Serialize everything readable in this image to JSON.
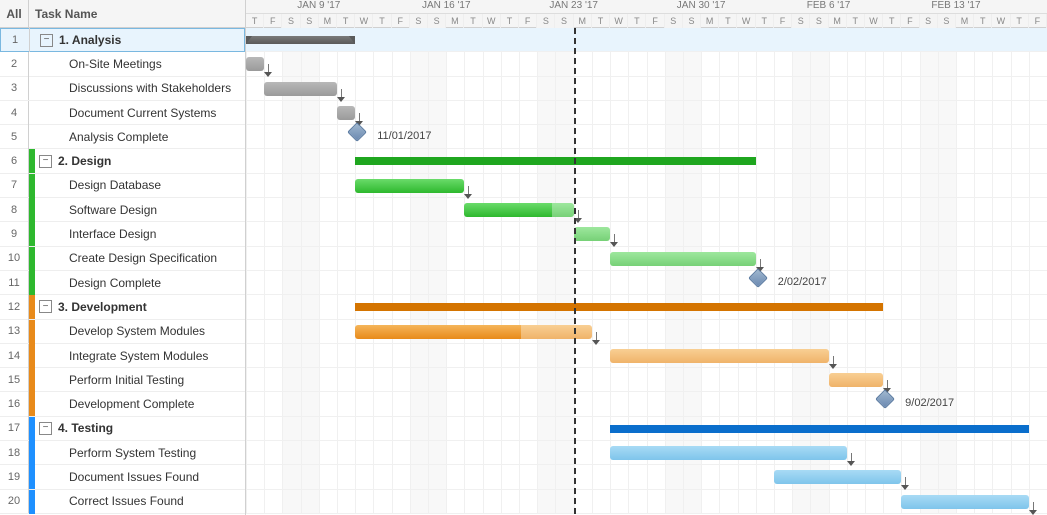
{
  "header": {
    "all": "All",
    "task_name": "Task Name"
  },
  "timeline": {
    "start": "2017-01-05",
    "days": 44,
    "today": "2017-01-23",
    "weeks": [
      {
        "label": "JAN 9 '17",
        "date": "2017-01-09"
      },
      {
        "label": "JAN 16 '17",
        "date": "2017-01-16"
      },
      {
        "label": "JAN 23 '17",
        "date": "2017-01-23"
      },
      {
        "label": "JAN 30 '17",
        "date": "2017-01-30"
      },
      {
        "label": "FEB 6 '17",
        "date": "2017-02-06"
      },
      {
        "label": "FEB 13 '17",
        "date": "2017-02-13"
      }
    ],
    "day_letters": [
      "S",
      "M",
      "T",
      "W",
      "T",
      "F",
      "S"
    ]
  },
  "tasks": [
    {
      "row": 1,
      "name": "1. Analysis",
      "phase": true,
      "color": "grey",
      "start": "2017-01-05",
      "end": "2017-01-11",
      "progress": 1,
      "selected": true
    },
    {
      "row": 2,
      "name": "On-Site Meetings",
      "parent": 1,
      "color": "grey",
      "start": "2017-01-05",
      "end": "2017-01-06",
      "progress": 1
    },
    {
      "row": 3,
      "name": "Discussions with Stakeholders",
      "parent": 1,
      "color": "grey",
      "start": "2017-01-06",
      "end": "2017-01-10",
      "progress": 1
    },
    {
      "row": 4,
      "name": "Document Current Systems",
      "parent": 1,
      "color": "grey",
      "start": "2017-01-10",
      "end": "2017-01-11",
      "progress": 1
    },
    {
      "row": 5,
      "name": "Analysis Complete",
      "parent": 1,
      "milestone": true,
      "start": "2017-01-11",
      "label": "11/01/2017"
    },
    {
      "row": 6,
      "name": "2. Design",
      "phase": true,
      "color": "green",
      "start": "2017-01-11",
      "end": "2017-02-02",
      "progress": 0.55
    },
    {
      "row": 7,
      "name": "Design Database",
      "parent": 6,
      "color": "green",
      "start": "2017-01-11",
      "end": "2017-01-17",
      "progress": 1
    },
    {
      "row": 8,
      "name": "Software Design",
      "parent": 6,
      "color": "green",
      "start": "2017-01-17",
      "end": "2017-01-23",
      "progress": 0.8
    },
    {
      "row": 9,
      "name": "Interface Design",
      "parent": 6,
      "color": "green",
      "start": "2017-01-23",
      "end": "2017-01-25",
      "progress": 0
    },
    {
      "row": 10,
      "name": "Create Design Specification",
      "parent": 6,
      "color": "green",
      "start": "2017-01-25",
      "end": "2017-02-02",
      "progress": 0
    },
    {
      "row": 11,
      "name": "Design Complete",
      "parent": 6,
      "milestone": true,
      "start": "2017-02-02",
      "label": "2/02/2017"
    },
    {
      "row": 12,
      "name": "3. Development",
      "phase": true,
      "color": "orange",
      "start": "2017-01-11",
      "end": "2017-02-09",
      "progress": 0.3
    },
    {
      "row": 13,
      "name": "Develop System Modules",
      "parent": 12,
      "color": "orange",
      "start": "2017-01-11",
      "end": "2017-01-24",
      "progress": 0.7
    },
    {
      "row": 14,
      "name": "Integrate System Modules",
      "parent": 12,
      "color": "orange",
      "start": "2017-01-25",
      "end": "2017-02-06",
      "progress": 0
    },
    {
      "row": 15,
      "name": "Perform Initial Testing",
      "parent": 12,
      "color": "orange",
      "start": "2017-02-06",
      "end": "2017-02-09",
      "progress": 0
    },
    {
      "row": 16,
      "name": "Development Complete",
      "parent": 12,
      "milestone": true,
      "start": "2017-02-09",
      "label": "9/02/2017"
    },
    {
      "row": 17,
      "name": "4. Testing",
      "phase": true,
      "color": "blue",
      "start": "2017-01-25",
      "end": "2017-02-17",
      "progress": 0
    },
    {
      "row": 18,
      "name": "Perform System Testing",
      "parent": 17,
      "color": "blue",
      "start": "2017-01-25",
      "end": "2017-02-07",
      "progress": 0
    },
    {
      "row": 19,
      "name": "Document Issues Found",
      "parent": 17,
      "color": "blue",
      "start": "2017-02-03",
      "end": "2017-02-10",
      "progress": 0
    },
    {
      "row": 20,
      "name": "Correct Issues Found",
      "parent": 17,
      "color": "blue",
      "start": "2017-02-10",
      "end": "2017-02-17",
      "progress": 0
    }
  ],
  "chart_data": {
    "type": "gantt",
    "title": "",
    "x_start": "2017-01-05",
    "x_end": "2017-02-17",
    "today_marker": "2017-01-23",
    "series": [
      {
        "id": 1,
        "name": "1. Analysis",
        "type": "summary",
        "start": "2017-01-05",
        "end": "2017-01-11",
        "progress": 1.0
      },
      {
        "id": 2,
        "name": "On-Site Meetings",
        "type": "task",
        "start": "2017-01-05",
        "end": "2017-01-06",
        "progress": 1.0,
        "parent": 1
      },
      {
        "id": 3,
        "name": "Discussions with Stakeholders",
        "type": "task",
        "start": "2017-01-06",
        "end": "2017-01-10",
        "progress": 1.0,
        "parent": 1,
        "depends": [
          2
        ]
      },
      {
        "id": 4,
        "name": "Document Current Systems",
        "type": "task",
        "start": "2017-01-10",
        "end": "2017-01-11",
        "progress": 1.0,
        "parent": 1,
        "depends": [
          3
        ]
      },
      {
        "id": 5,
        "name": "Analysis Complete",
        "type": "milestone",
        "start": "2017-01-11",
        "label": "11/01/2017",
        "parent": 1,
        "depends": [
          4
        ]
      },
      {
        "id": 6,
        "name": "2. Design",
        "type": "summary",
        "start": "2017-01-11",
        "end": "2017-02-02",
        "progress": 0.55
      },
      {
        "id": 7,
        "name": "Design Database",
        "type": "task",
        "start": "2017-01-11",
        "end": "2017-01-17",
        "progress": 1.0,
        "parent": 6,
        "depends": [
          5
        ]
      },
      {
        "id": 8,
        "name": "Software Design",
        "type": "task",
        "start": "2017-01-17",
        "end": "2017-01-23",
        "progress": 0.8,
        "parent": 6,
        "depends": [
          7
        ]
      },
      {
        "id": 9,
        "name": "Interface Design",
        "type": "task",
        "start": "2017-01-23",
        "end": "2017-01-25",
        "progress": 0.0,
        "parent": 6,
        "depends": [
          8
        ]
      },
      {
        "id": 10,
        "name": "Create Design Specification",
        "type": "task",
        "start": "2017-01-25",
        "end": "2017-02-02",
        "progress": 0.0,
        "parent": 6,
        "depends": [
          9
        ]
      },
      {
        "id": 11,
        "name": "Design Complete",
        "type": "milestone",
        "start": "2017-02-02",
        "label": "2/02/2017",
        "parent": 6,
        "depends": [
          10
        ]
      },
      {
        "id": 12,
        "name": "3. Development",
        "type": "summary",
        "start": "2017-01-11",
        "end": "2017-02-09",
        "progress": 0.3
      },
      {
        "id": 13,
        "name": "Develop System Modules",
        "type": "task",
        "start": "2017-01-11",
        "end": "2017-01-24",
        "progress": 0.7,
        "parent": 12
      },
      {
        "id": 14,
        "name": "Integrate System Modules",
        "type": "task",
        "start": "2017-01-25",
        "end": "2017-02-06",
        "progress": 0.0,
        "parent": 12,
        "depends": [
          13
        ]
      },
      {
        "id": 15,
        "name": "Perform Initial Testing",
        "type": "task",
        "start": "2017-02-06",
        "end": "2017-02-09",
        "progress": 0.0,
        "parent": 12,
        "depends": [
          14
        ]
      },
      {
        "id": 16,
        "name": "Development Complete",
        "type": "milestone",
        "start": "2017-02-09",
        "label": "9/02/2017",
        "parent": 12,
        "depends": [
          15
        ]
      },
      {
        "id": 17,
        "name": "4. Testing",
        "type": "summary",
        "start": "2017-01-25",
        "end": "2017-02-17",
        "progress": 0.0
      },
      {
        "id": 18,
        "name": "Perform System Testing",
        "type": "task",
        "start": "2017-01-25",
        "end": "2017-02-07",
        "progress": 0.0,
        "parent": 17
      },
      {
        "id": 19,
        "name": "Document Issues Found",
        "type": "task",
        "start": "2017-02-03",
        "end": "2017-02-10",
        "progress": 0.0,
        "parent": 17
      },
      {
        "id": 20,
        "name": "Correct Issues Found",
        "type": "task",
        "start": "2017-02-10",
        "end": "2017-02-17",
        "progress": 0.0,
        "parent": 17,
        "depends": [
          19
        ]
      }
    ]
  }
}
